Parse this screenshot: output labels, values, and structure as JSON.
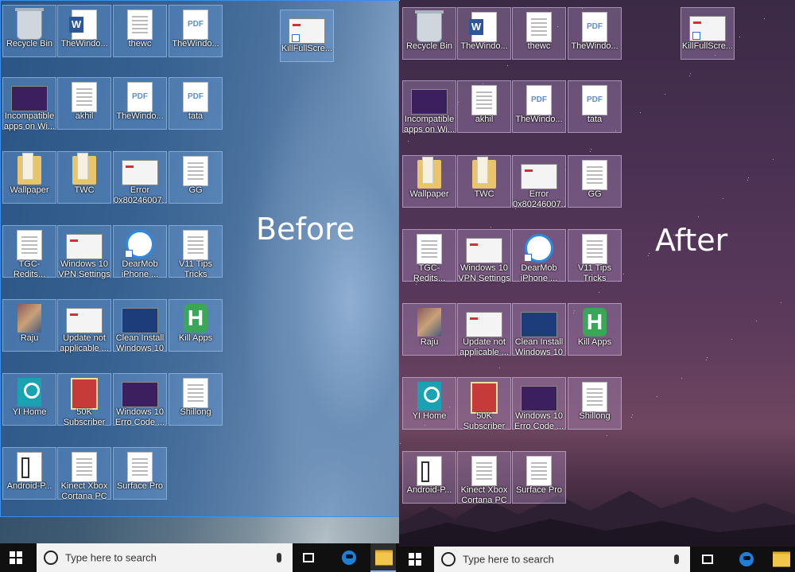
{
  "panels": {
    "left": {
      "caption": "Before",
      "icons": [
        {
          "label": "Recycle Bin",
          "icon": "recycle-bin-icon"
        },
        {
          "label": "TheWindo...",
          "icon": "word-doc-icon"
        },
        {
          "label": "thewc",
          "icon": "document-icon"
        },
        {
          "label": "TheWindo...",
          "icon": "pdf-icon"
        },
        {
          "label": "KillFullScre...",
          "icon": "app-shortcut-icon"
        },
        {
          "label": "Incompatible apps on Wi...",
          "icon": "screenshot-purple-icon"
        },
        {
          "label": "akhil",
          "icon": "document-icon"
        },
        {
          "label": "TheWindo...",
          "icon": "pdf-icon"
        },
        {
          "label": "tata",
          "icon": "pdf-icon"
        },
        {
          "label": "Wallpaper",
          "icon": "folder-icon"
        },
        {
          "label": "TWC",
          "icon": "folder-icon"
        },
        {
          "label": "Error 0x80246007...",
          "icon": "screenshot-white-icon"
        },
        {
          "label": "GG",
          "icon": "document-icon"
        },
        {
          "label": "TGC-Redits...",
          "icon": "blank-doc-icon"
        },
        {
          "label": "Windows 10 VPN Settings",
          "icon": "screenshot-white-icon"
        },
        {
          "label": "DearMob iPhone ...",
          "icon": "dearmob-icon"
        },
        {
          "label": "V11 Tips Tricks",
          "icon": "document-icon"
        },
        {
          "label": "Raju",
          "icon": "photo-icon"
        },
        {
          "label": "Update not applicable ...",
          "icon": "screenshot-white-icon"
        },
        {
          "label": "Clean Install Windows 10",
          "icon": "screenshot-blue-icon"
        },
        {
          "label": "Kill Apps",
          "icon": "kill-apps-icon"
        },
        {
          "label": "YI Home",
          "icon": "yi-home-icon"
        },
        {
          "label": "50K Subscriber",
          "icon": "poster-icon"
        },
        {
          "label": "Windows 10 Erro Code ...",
          "icon": "screenshot-purple-icon"
        },
        {
          "label": "Shillong",
          "icon": "document-icon"
        },
        {
          "label": "Android-P...",
          "icon": "phones-icon"
        },
        {
          "label": "Kinect Xbox Cortana PC",
          "icon": "document-icon"
        },
        {
          "label": "Surface Pro",
          "icon": "document-icon"
        }
      ]
    },
    "right": {
      "caption": "After",
      "icons": [
        {
          "label": "Recycle Bin",
          "icon": "recycle-bin-icon"
        },
        {
          "label": "TheWindo...",
          "icon": "word-doc-icon"
        },
        {
          "label": "thewc",
          "icon": "document-icon"
        },
        {
          "label": "TheWindo...",
          "icon": "pdf-icon"
        },
        {
          "label": "KillFullScre...",
          "icon": "app-shortcut-icon"
        },
        {
          "label": "Incompatible apps on Wi...",
          "icon": "screenshot-purple-icon"
        },
        {
          "label": "akhil",
          "icon": "document-icon"
        },
        {
          "label": "TheWindo...",
          "icon": "pdf-icon"
        },
        {
          "label": "tata",
          "icon": "pdf-icon"
        },
        {
          "label": "Wallpaper",
          "icon": "folder-icon"
        },
        {
          "label": "TWC",
          "icon": "folder-icon"
        },
        {
          "label": "Error 0x80246007...",
          "icon": "screenshot-white-icon"
        },
        {
          "label": "GG",
          "icon": "document-icon"
        },
        {
          "label": "TGC-Redits...",
          "icon": "blank-doc-icon"
        },
        {
          "label": "Windows 10 VPN Settings",
          "icon": "screenshot-white-icon"
        },
        {
          "label": "DearMob iPhone ...",
          "icon": "dearmob-icon"
        },
        {
          "label": "V11 Tips Tricks",
          "icon": "document-icon"
        },
        {
          "label": "Raju",
          "icon": "photo-icon"
        },
        {
          "label": "Update not applicable ...",
          "icon": "screenshot-white-icon"
        },
        {
          "label": "Clean Install Windows 10",
          "icon": "screenshot-blue-icon"
        },
        {
          "label": "Kill Apps",
          "icon": "kill-apps-icon"
        },
        {
          "label": "YI Home",
          "icon": "yi-home-icon"
        },
        {
          "label": "50K Subscriber",
          "icon": "poster-icon"
        },
        {
          "label": "Windows 10 Erro Code ...",
          "icon": "screenshot-purple-icon"
        },
        {
          "label": "Shillong",
          "icon": "document-icon"
        },
        {
          "label": "Android-P...",
          "icon": "phones-icon"
        },
        {
          "label": "Kinect Xbox Cortana PC",
          "icon": "document-icon"
        },
        {
          "label": "Surface Pro",
          "icon": "document-icon"
        }
      ]
    }
  },
  "taskbar": {
    "search_placeholder": "Type here to search",
    "start_icon": "windows-logo-icon",
    "items": [
      "task-view-icon",
      "edge-icon",
      "file-explorer-icon"
    ]
  },
  "colors": {
    "selection_before": "#3c8fe8",
    "wallpaper_after": "#4a3153"
  }
}
